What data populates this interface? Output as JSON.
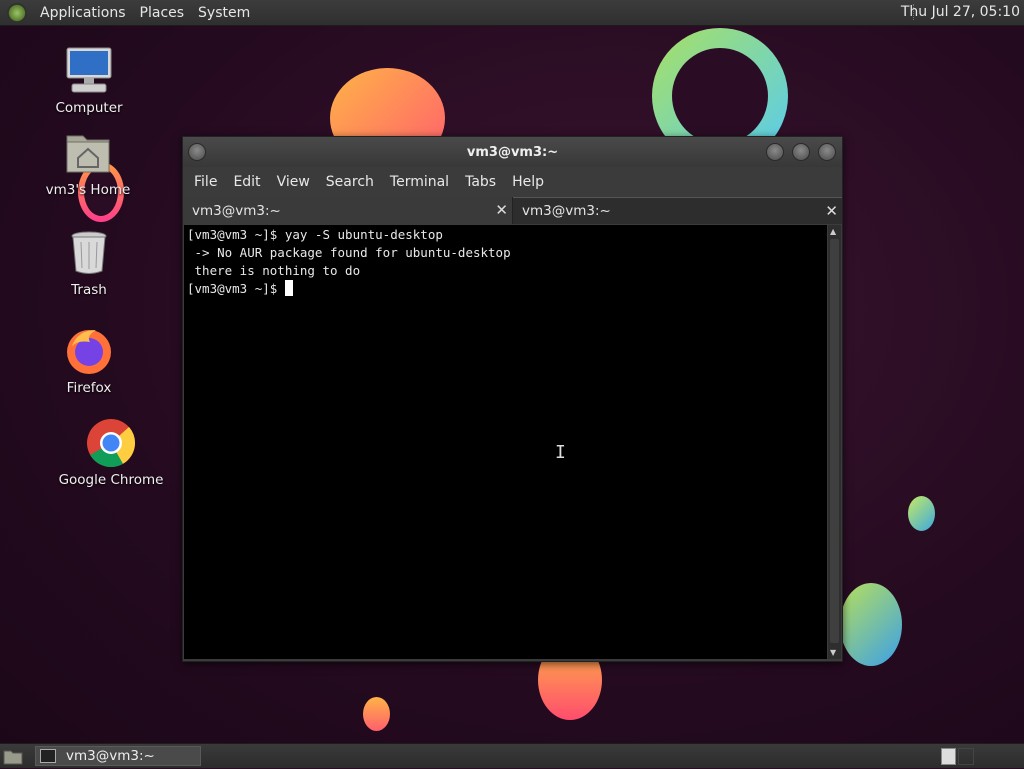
{
  "top_panel": {
    "menus": [
      "Applications",
      "Places",
      "System"
    ],
    "clock": "Thu Jul 27, 05:10"
  },
  "desktop_icons": [
    {
      "label": "Computer",
      "icon": "computer-icon"
    },
    {
      "label": "vm3's Home",
      "icon": "home-folder-icon"
    },
    {
      "label": "Trash",
      "icon": "trash-icon"
    },
    {
      "label": "Firefox",
      "icon": "firefox-icon"
    },
    {
      "label": "Google Chrome",
      "icon": "chrome-icon"
    }
  ],
  "window": {
    "title": "vm3@vm3:~",
    "menu": [
      "File",
      "Edit",
      "View",
      "Search",
      "Terminal",
      "Tabs",
      "Help"
    ],
    "tabs": [
      {
        "label": "vm3@vm3:~",
        "active": false
      },
      {
        "label": "vm3@vm3:~",
        "active": true
      }
    ],
    "terminal_lines": [
      "[vm3@vm3 ~]$ yay -S ubuntu-desktop",
      " -> No AUR package found for ubuntu-desktop",
      " there is nothing to do",
      "[vm3@vm3 ~]$ "
    ]
  },
  "taskbar": {
    "task_label": "vm3@vm3:~"
  },
  "colors": {
    "wallpaper": "#2a0d24",
    "terminal_bg": "#000000",
    "panel": "#333333"
  }
}
